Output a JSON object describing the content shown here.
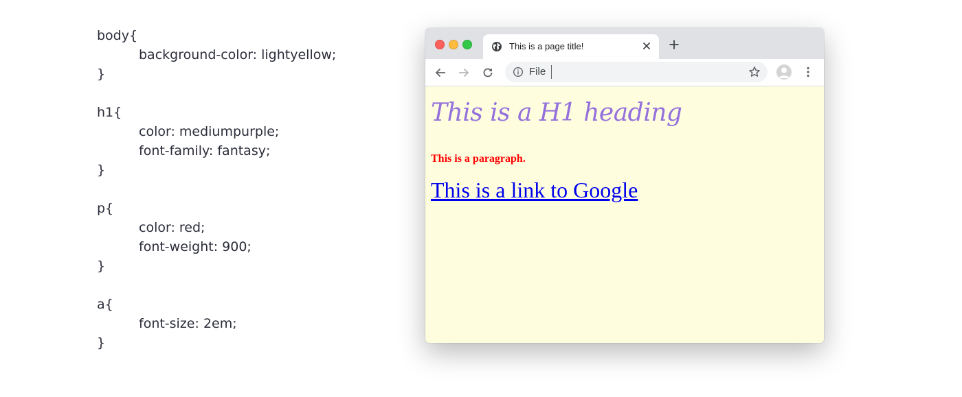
{
  "code": {
    "lines": [
      {
        "text": "body{",
        "indent": false
      },
      {
        "text": "background-color: lightyellow;",
        "indent": true
      },
      {
        "text": "}",
        "indent": false
      },
      {
        "text": "",
        "indent": false
      },
      {
        "text": "h1{",
        "indent": false
      },
      {
        "text": "color: mediumpurple;",
        "indent": true
      },
      {
        "text": "font-family: fantasy;",
        "indent": true
      },
      {
        "text": "}",
        "indent": false
      },
      {
        "text": "",
        "indent": false
      },
      {
        "text": "p{",
        "indent": false
      },
      {
        "text": "color: red;",
        "indent": true
      },
      {
        "text": "font-weight: 900;",
        "indent": true
      },
      {
        "text": "}",
        "indent": false
      },
      {
        "text": "",
        "indent": false
      },
      {
        "text": "a{",
        "indent": false
      },
      {
        "text": "font-size: 2em;",
        "indent": true
      },
      {
        "text": "}",
        "indent": false
      }
    ]
  },
  "browser": {
    "tab_title": "This is a page title!",
    "address": "File",
    "icons": {
      "favicon": "globe-icon",
      "close": "close-icon",
      "new_tab": "plus-icon",
      "back": "back-arrow-icon",
      "forward": "forward-arrow-icon",
      "reload": "reload-icon",
      "info": "info-icon",
      "bookmark": "star-icon",
      "profile": "avatar-icon",
      "menu": "kebab-menu-icon"
    }
  },
  "page": {
    "h1": "This is a H1 heading",
    "paragraph": "This is a paragraph.",
    "link": "This is a link to Google"
  },
  "colors": {
    "page_background": "#fefedf",
    "heading": "#9370db",
    "paragraph": "#ff0000",
    "link": "#0000ee"
  }
}
